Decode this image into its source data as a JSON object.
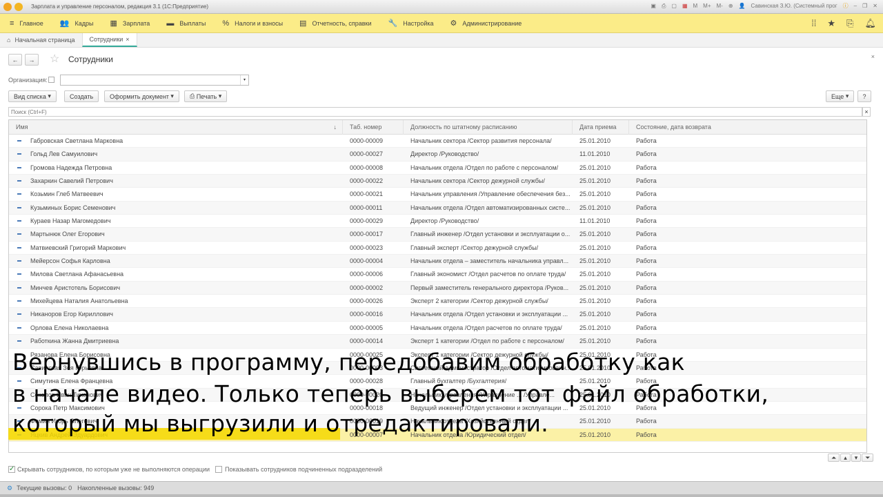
{
  "window": {
    "title": "Зарплата и управление персоналом, редакция 3.1  (1С:Предприятие)",
    "user": "Савинская З.Ю. (Системный прог",
    "m": "M",
    "mplus": "M+",
    "mminus": "M-",
    "logo": "1С"
  },
  "menu": [
    {
      "icon": "≡",
      "label": "Главное"
    },
    {
      "icon": "👥",
      "label": "Кадры"
    },
    {
      "icon": "▦",
      "label": "Зарплата"
    },
    {
      "icon": "▬",
      "label": "Выплаты"
    },
    {
      "icon": "%",
      "label": "Налоги и взносы"
    },
    {
      "icon": "▤",
      "label": "Отчетность, справки"
    },
    {
      "icon": "🔧",
      "label": "Настройка"
    },
    {
      "icon": "⚙",
      "label": "Администрирование"
    }
  ],
  "tabs": {
    "home": "Начальная страница",
    "active": "Сотрудники"
  },
  "form": {
    "title": "Сотрудники",
    "org_label": "Организация:",
    "org_value": "",
    "list_view": "Вид списка",
    "create": "Создать",
    "document": "Оформить документ",
    "print": "Печать",
    "more": "Еще",
    "help": "?",
    "search_placeholder": "Поиск (Ctrl+F)"
  },
  "table": {
    "columns": [
      "Имя",
      "Таб. номер",
      "Должность по штатному расписанию",
      "Дата приема",
      "Состояние, дата возврата"
    ],
    "rows": [
      [
        "Габровская Светлана Марковна",
        "0000-00009",
        "Начальник сектора /Сектор развития персонала/",
        "25.01.2010",
        "Работа"
      ],
      [
        "Гольд Лев Самуилович",
        "0000-00027",
        "Директор /Руководство/",
        "11.01.2010",
        "Работа"
      ],
      [
        "Громова Надежда Петровна",
        "0000-00008",
        "Начальник отдела /Отдел по работе с персоналом/",
        "25.01.2010",
        "Работа"
      ],
      [
        "Захаркин Савелий Петрович",
        "0000-00022",
        "Начальник сектора /Сектор дежурной службы/",
        "25.01.2010",
        "Работа"
      ],
      [
        "Козьмин Глеб Матвеевич",
        "0000-00021",
        "Начальник управления /Управление обеспечения без...",
        "25.01.2010",
        "Работа"
      ],
      [
        "Кузьминых Борис Семенович",
        "0000-00011",
        "Начальник отдела /Отдел автоматизированных систе...",
        "25.01.2010",
        "Работа"
      ],
      [
        "Кураев Назар Магомедович",
        "0000-00029",
        "Директор /Руководство/",
        "11.01.2010",
        "Работа"
      ],
      [
        "Мартынюк Олег Егорович",
        "0000-00017",
        "Главный инженер /Отдел установки и эксплуатации о...",
        "25.01.2010",
        "Работа"
      ],
      [
        "Матвиевский Григорий Маркович",
        "0000-00023",
        "Главный эксперт /Сектор дежурной службы/",
        "25.01.2010",
        "Работа"
      ],
      [
        "Мейерсон Софья Карловна",
        "0000-00004",
        "Начальник отдела – заместитель начальника управл...",
        "25.01.2010",
        "Работа"
      ],
      [
        "Милова Светлана Афанасьевна",
        "0000-00006",
        "Главный экономист /Отдел расчетов по оплате труда/",
        "25.01.2010",
        "Работа"
      ],
      [
        "Минчев Аристотель Борисович",
        "0000-00002",
        "Первый заместитель генерального директора /Руков...",
        "25.01.2010",
        "Работа"
      ],
      [
        "Михейцева Наталия Анатольевна",
        "0000-00026",
        "Эксперт 2 категории /Сектор дежурной службы/",
        "25.01.2010",
        "Работа"
      ],
      [
        "Никаноров Егор Кириллович",
        "0000-00016",
        "Начальник отдела /Отдел установки и эксплуатации ...",
        "25.01.2010",
        "Работа"
      ],
      [
        "Орлова Елена Николаевна",
        "0000-00005",
        "Начальник отдела /Отдел расчетов по оплате труда/",
        "25.01.2010",
        "Работа"
      ],
      [
        "Работкина Жанна Дмитриевна",
        "0000-00014",
        "Эксперт 1 категории /Отдел по работе с персоналом/",
        "25.01.2010",
        "Работа"
      ],
      [
        "Рязанова Елена Борисовна",
        "0000-00025",
        "Эксперт 1 категории /Сектор дежурной службы/",
        "25.01.2010",
        "Работа"
      ],
      [
        "Савинская Зоя Юрьевна",
        "0000-00003",
        "Системный администратор /Отдел автоматизированн...",
        "25.01.2010",
        "Работа"
      ],
      [
        "Симутина Елена Францевна",
        "0000-00028",
        "Главный бухгалтер /Бухгалтерия/",
        "25.01.2010",
        "Работа"
      ],
      [
        "Соколов Иван Тихонович",
        "0000-00020",
        "Начальник управления /Управление ... /Управле...",
        "25.01.2010",
        "Работа"
      ],
      [
        "Сорока Петр Максимович",
        "0000-00018",
        "Ведущий инженер /Отдел установки и эксплуатации ...",
        "25.01.2010",
        "Работа"
      ],
      [
        "Фомин Игорь Олегович",
        "0000-00019",
        "Начальник отдела /Хозяйственный отдел/",
        "25.01.2010",
        "Работа"
      ],
      [
        "Яцкив Андрей Эдуардович",
        "0000-00007",
        "Начальник отдела /Юридический отдел/",
        "25.01.2010",
        "Работа"
      ]
    ]
  },
  "options": {
    "hide_label": "Скрывать сотрудников, по которым уже не выполняются операции",
    "hide_checked": true,
    "show_sub_label": "Показывать сотрудников подчиненных подразделений",
    "show_sub_checked": false
  },
  "status": {
    "current": "Текущие вызовы: 0",
    "accumulated": "Накопленные вызовы: 949"
  },
  "subtitles": [
    "Вернувшись в программу, передобавим обработку как",
    "в начале видео. Только теперь выберем тот файл обработки,",
    "который мы выгрузили и отредактировали."
  ]
}
